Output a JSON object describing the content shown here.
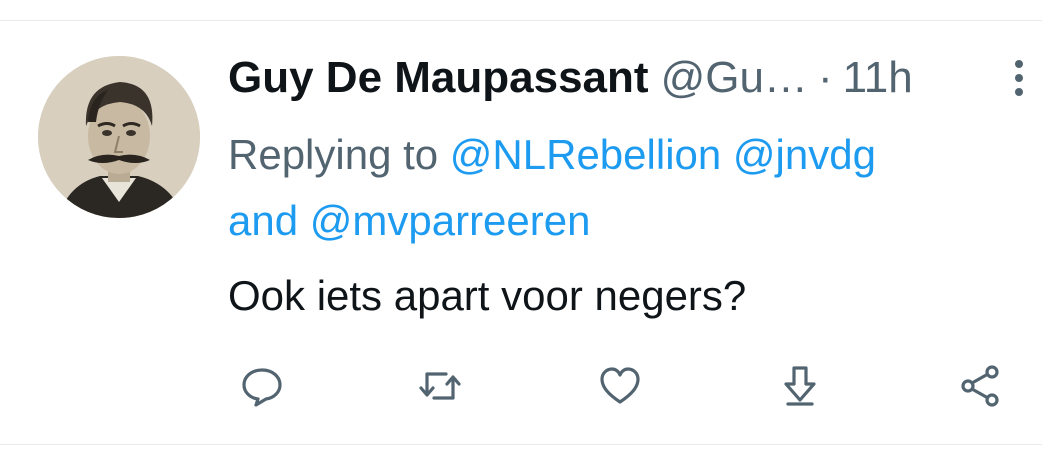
{
  "tweet": {
    "author": {
      "display_name": "Guy De Maupassant",
      "handle": "@Gu…",
      "avatar_icon": "profile-photo"
    },
    "separator": "·",
    "time": "11h",
    "reply": {
      "prefix": "Replying to",
      "mentions": [
        "@NLRebellion",
        "@jnvdg",
        "@mvparreeren"
      ],
      "conjunction": "and"
    },
    "text": "Ook iets apart voor negers?",
    "actions": [
      {
        "name": "reply",
        "icon": "speech-bubble-icon"
      },
      {
        "name": "retweet",
        "icon": "retweet-icon"
      },
      {
        "name": "like",
        "icon": "heart-icon"
      },
      {
        "name": "download",
        "icon": "download-icon"
      },
      {
        "name": "share",
        "icon": "share-icon"
      }
    ],
    "colors": {
      "text": "#0f1419",
      "secondary": "#536471",
      "link": "#1d9bf0",
      "divider": "#e8ebed"
    }
  }
}
